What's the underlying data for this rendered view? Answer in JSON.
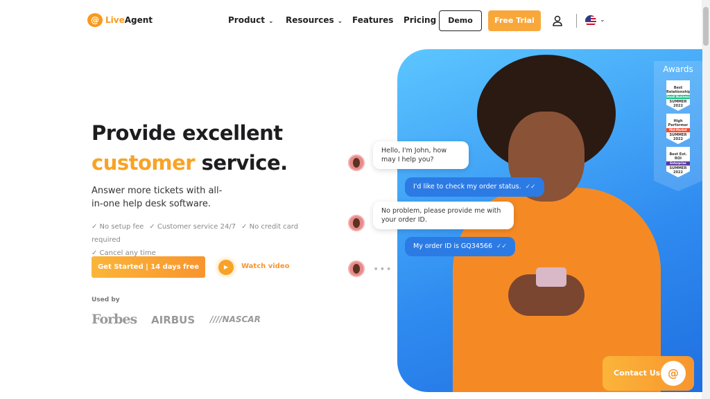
{
  "nav": {
    "logo_mark": "@",
    "logo_live": "Live",
    "logo_agent": "Agent",
    "items": [
      "Product",
      "Resources",
      "Features",
      "Pricing"
    ],
    "demo": "Demo",
    "trial": "Free Trial",
    "user_icon": "user-icon",
    "language": "en-US"
  },
  "hero": {
    "line1": "Provide excellent",
    "highlight": "customer",
    "line2_rest": " service.",
    "subtitle": "Answer more tickets with all-in-one help desk software.",
    "features": [
      "✓ No setup fee",
      "✓ Customer service 24/7",
      "✓ No credit card required",
      "✓ Cancel any time"
    ],
    "cta": "Get Started | 14 days free",
    "watch": "Watch video",
    "used_by": "Used by",
    "brands": [
      "Forbes",
      "AIRBUS",
      "////NASCAR"
    ]
  },
  "chat": [
    {
      "from": "agent",
      "text": "Hello, I'm John, how may I help you?"
    },
    {
      "from": "customer",
      "text": "I'd like to check my order status."
    },
    {
      "from": "agent",
      "text": "No problem, please provide me with your order ID."
    },
    {
      "from": "customer",
      "text": "My order ID is GQ34566"
    }
  ],
  "awards": {
    "title": "Awards",
    "badges": [
      {
        "title": "Best Relationship",
        "strip": "Small Business",
        "season": "SUMMER 2022",
        "color": "#1ec28b"
      },
      {
        "title": "High Performer",
        "strip": "Mid-Market",
        "season": "SUMMER 2022",
        "color": "#ff492c"
      },
      {
        "title": "Best Est. ROI",
        "strip": "Enterprise",
        "season": "SUMMER 2022",
        "color": "#5a39a2"
      }
    ]
  },
  "contact": {
    "label": "Contact Us",
    "icon": "@"
  },
  "colors": {
    "accent": "#f8a326",
    "blue": "#2c7be5"
  }
}
